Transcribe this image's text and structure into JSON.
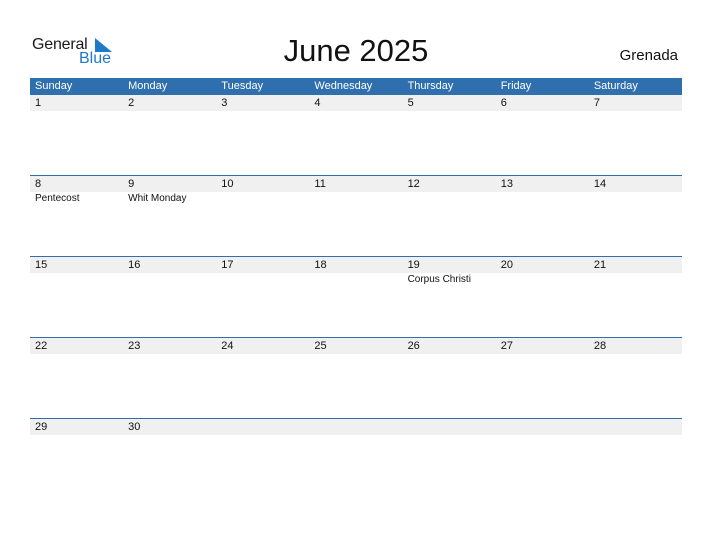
{
  "logo": {
    "general": "General",
    "blue": "Blue"
  },
  "title": "June 2025",
  "country": "Grenada",
  "weekdays": [
    "Sunday",
    "Monday",
    "Tuesday",
    "Wednesday",
    "Thursday",
    "Friday",
    "Saturday"
  ],
  "weeks": [
    {
      "days": [
        "1",
        "2",
        "3",
        "4",
        "5",
        "6",
        "7"
      ],
      "events": [
        "",
        "",
        "",
        "",
        "",
        "",
        ""
      ]
    },
    {
      "days": [
        "8",
        "9",
        "10",
        "11",
        "12",
        "13",
        "14"
      ],
      "events": [
        "Pentecost",
        "Whit Monday",
        "",
        "",
        "",
        "",
        ""
      ]
    },
    {
      "days": [
        "15",
        "16",
        "17",
        "18",
        "19",
        "20",
        "21"
      ],
      "events": [
        "",
        "",
        "",
        "",
        "Corpus Christi",
        "",
        ""
      ]
    },
    {
      "days": [
        "22",
        "23",
        "24",
        "25",
        "26",
        "27",
        "28"
      ],
      "events": [
        "",
        "",
        "",
        "",
        "",
        "",
        ""
      ]
    },
    {
      "days": [
        "29",
        "30",
        "",
        "",
        "",
        "",
        ""
      ],
      "events": [
        "",
        "",
        "",
        "",
        "",
        "",
        ""
      ]
    }
  ],
  "colors": {
    "header": "#2f6fad",
    "brand_blue": "#1e7ac8",
    "day_row": "#f0f0f0"
  }
}
